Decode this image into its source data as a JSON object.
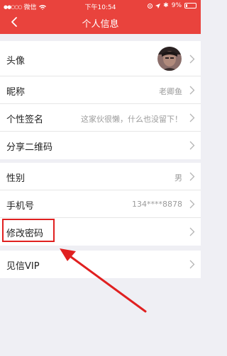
{
  "status": {
    "carrier": "微信",
    "time": "下午10:54",
    "battery": "9%"
  },
  "nav": {
    "title": "个人信息"
  },
  "rows": {
    "avatar": {
      "label": "头像"
    },
    "nickname": {
      "label": "昵称",
      "value": "老卿鱼"
    },
    "signature": {
      "label": "个性签名",
      "value": "这家伙很懒，什么也没留下！"
    },
    "qrcode": {
      "label": "分享二维码"
    },
    "gender": {
      "label": "性别",
      "value": "男"
    },
    "phone": {
      "label": "手机号",
      "value": "134****8878"
    },
    "password": {
      "label": "修改密码"
    },
    "vip": {
      "label": "见信VIP"
    }
  },
  "colors": {
    "brand": "#e9433d",
    "annotation": "#e02020"
  },
  "icons": {
    "back": "chevron-left-icon",
    "disclosure": "chevron-right-icon"
  }
}
